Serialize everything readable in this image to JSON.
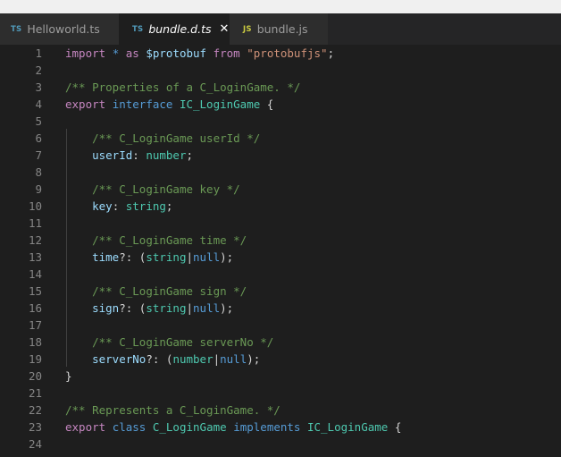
{
  "tabs": [
    {
      "icon": "TS",
      "icon_name": "typescript-file-icon",
      "label": "Helloworld.ts",
      "active": false,
      "italic": false
    },
    {
      "icon": "TS",
      "icon_name": "typescript-file-icon",
      "label": "bundle.d.ts",
      "active": true,
      "italic": true,
      "close_glyph": "✕"
    },
    {
      "icon": "JS",
      "icon_name": "javascript-file-icon",
      "label": "bundle.js",
      "active": false,
      "italic": false
    }
  ],
  "colors": {
    "background": "#1e1e1e",
    "keyword": "#569cd6",
    "control": "#c586c0",
    "comment": "#6a9955",
    "string": "#ce9178",
    "type": "#4ec9b0",
    "property": "#9cdcfe",
    "line_number": "#858585",
    "ts_icon": "#519aba",
    "js_icon": "#cbcb41"
  },
  "editor": {
    "lines": [
      {
        "n": "1",
        "tokens": [
          [
            "ctl",
            "import"
          ],
          [
            "punc",
            " "
          ],
          [
            "kw",
            "*"
          ],
          [
            "punc",
            " "
          ],
          [
            "ctl",
            "as"
          ],
          [
            "punc",
            " "
          ],
          [
            "var",
            "$protobuf"
          ],
          [
            "punc",
            " "
          ],
          [
            "ctl",
            "from"
          ],
          [
            "punc",
            " "
          ],
          [
            "str",
            "\"protobufjs\""
          ],
          [
            "punc",
            ";"
          ]
        ]
      },
      {
        "n": "2",
        "tokens": []
      },
      {
        "n": "3",
        "tokens": [
          [
            "cm",
            "/** Properties of a C_LoginGame. */"
          ]
        ]
      },
      {
        "n": "4",
        "tokens": [
          [
            "ctl",
            "export"
          ],
          [
            "punc",
            " "
          ],
          [
            "kw",
            "interface"
          ],
          [
            "punc",
            " "
          ],
          [
            "type",
            "IC_LoginGame"
          ],
          [
            "punc",
            " {"
          ]
        ]
      },
      {
        "n": "5",
        "tokens": []
      },
      {
        "n": "6",
        "tokens": [
          [
            "punc",
            "    "
          ],
          [
            "cm",
            "/** C_LoginGame userId */"
          ]
        ]
      },
      {
        "n": "7",
        "tokens": [
          [
            "punc",
            "    "
          ],
          [
            "prop",
            "userId"
          ],
          [
            "punc",
            ": "
          ],
          [
            "type",
            "number"
          ],
          [
            "punc",
            ";"
          ]
        ]
      },
      {
        "n": "8",
        "tokens": []
      },
      {
        "n": "9",
        "tokens": [
          [
            "punc",
            "    "
          ],
          [
            "cm",
            "/** C_LoginGame key */"
          ]
        ]
      },
      {
        "n": "10",
        "tokens": [
          [
            "punc",
            "    "
          ],
          [
            "prop",
            "key"
          ],
          [
            "punc",
            ": "
          ],
          [
            "type",
            "string"
          ],
          [
            "punc",
            ";"
          ]
        ]
      },
      {
        "n": "11",
        "tokens": []
      },
      {
        "n": "12",
        "tokens": [
          [
            "punc",
            "    "
          ],
          [
            "cm",
            "/** C_LoginGame time */"
          ]
        ]
      },
      {
        "n": "13",
        "tokens": [
          [
            "punc",
            "    "
          ],
          [
            "prop",
            "time"
          ],
          [
            "punc",
            "?: ("
          ],
          [
            "type",
            "string"
          ],
          [
            "punc",
            "|"
          ],
          [
            "kw",
            "null"
          ],
          [
            "punc",
            ");"
          ]
        ]
      },
      {
        "n": "14",
        "tokens": []
      },
      {
        "n": "15",
        "tokens": [
          [
            "punc",
            "    "
          ],
          [
            "cm",
            "/** C_LoginGame sign */"
          ]
        ]
      },
      {
        "n": "16",
        "tokens": [
          [
            "punc",
            "    "
          ],
          [
            "prop",
            "sign"
          ],
          [
            "punc",
            "?: ("
          ],
          [
            "type",
            "string"
          ],
          [
            "punc",
            "|"
          ],
          [
            "kw",
            "null"
          ],
          [
            "punc",
            ");"
          ]
        ]
      },
      {
        "n": "17",
        "tokens": []
      },
      {
        "n": "18",
        "tokens": [
          [
            "punc",
            "    "
          ],
          [
            "cm",
            "/** C_LoginGame serverNo */"
          ]
        ]
      },
      {
        "n": "19",
        "tokens": [
          [
            "punc",
            "    "
          ],
          [
            "prop",
            "serverNo"
          ],
          [
            "punc",
            "?: ("
          ],
          [
            "type",
            "number"
          ],
          [
            "punc",
            "|"
          ],
          [
            "kw",
            "null"
          ],
          [
            "punc",
            ");"
          ]
        ]
      },
      {
        "n": "20",
        "tokens": [
          [
            "punc",
            "}"
          ]
        ]
      },
      {
        "n": "21",
        "tokens": []
      },
      {
        "n": "22",
        "tokens": [
          [
            "cm",
            "/** Represents a C_LoginGame. */"
          ]
        ]
      },
      {
        "n": "23",
        "tokens": [
          [
            "ctl",
            "export"
          ],
          [
            "punc",
            " "
          ],
          [
            "kw",
            "class"
          ],
          [
            "punc",
            " "
          ],
          [
            "type",
            "C_LoginGame"
          ],
          [
            "punc",
            " "
          ],
          [
            "kw",
            "implements"
          ],
          [
            "punc",
            " "
          ],
          [
            "type",
            "IC_LoginGame"
          ],
          [
            "punc",
            " {"
          ]
        ]
      },
      {
        "n": "24",
        "tokens": []
      },
      {
        "n": "",
        "tokens": [
          [
            "punc",
            "    "
          ],
          [
            "cm",
            "/**"
          ]
        ]
      }
    ]
  }
}
